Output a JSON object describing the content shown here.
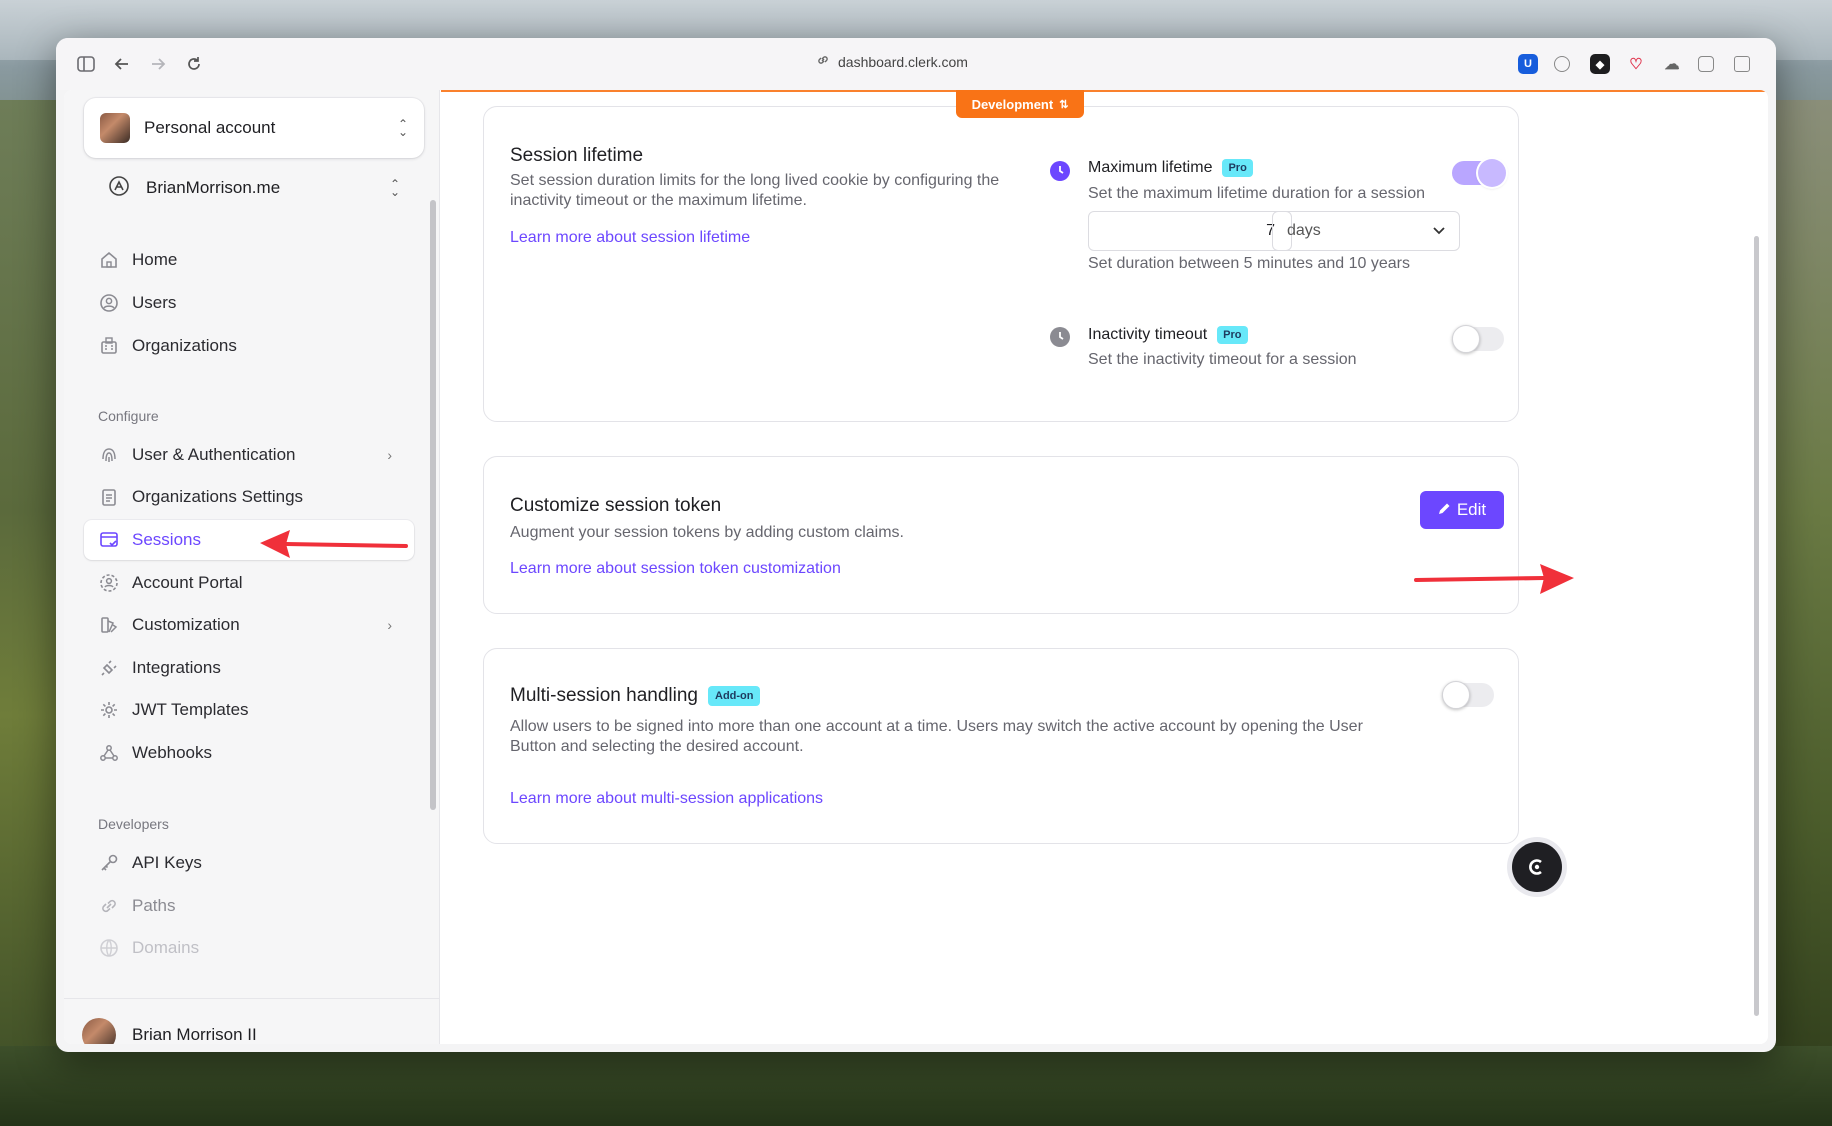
{
  "browser": {
    "url": "dashboard.clerk.com"
  },
  "sidebar": {
    "account": "Personal account",
    "app": "BrianMorrison.me",
    "nav_top": [
      {
        "label": "Home",
        "icon": "home-icon"
      },
      {
        "label": "Users",
        "icon": "users-icon"
      },
      {
        "label": "Organizations",
        "icon": "building-icon"
      }
    ],
    "configure_label": "Configure",
    "configure": [
      {
        "label": "User & Authentication",
        "icon": "fingerprint-icon"
      },
      {
        "label": "Organizations Settings",
        "icon": "clipboard-icon"
      },
      {
        "label": "Sessions",
        "icon": "sessions-icon"
      },
      {
        "label": "Account Portal",
        "icon": "portal-icon"
      },
      {
        "label": "Customization",
        "icon": "customization-icon"
      },
      {
        "label": "Integrations",
        "icon": "plug-icon"
      },
      {
        "label": "JWT Templates",
        "icon": "gear-icon"
      },
      {
        "label": "Webhooks",
        "icon": "webhook-icon"
      }
    ],
    "developers_label": "Developers",
    "developers": [
      {
        "label": "API Keys",
        "icon": "key-icon"
      },
      {
        "label": "Paths",
        "icon": "link-icon"
      },
      {
        "label": "Domains",
        "icon": "globe-icon"
      }
    ],
    "user_name": "Brian Morrison II"
  },
  "env_badge": "Development",
  "session_lifetime": {
    "title": "Session lifetime",
    "description": "Set session duration limits for the long lived cookie by configuring the inactivity timeout or the maximum lifetime.",
    "link": "Learn more about session lifetime",
    "max_lifetime": {
      "title": "Maximum lifetime",
      "badge": "Pro",
      "description": "Set the maximum lifetime duration for a session",
      "value": "7",
      "unit": "days",
      "hint": "Set duration between 5 minutes and 10 years",
      "enabled": true
    },
    "inactivity": {
      "title": "Inactivity timeout",
      "badge": "Pro",
      "description": "Set the inactivity timeout for a session",
      "enabled": false
    }
  },
  "session_token": {
    "title": "Customize session token",
    "description": "Augment your session tokens by adding custom claims.",
    "link": "Learn more about session token customization",
    "edit_label": "Edit"
  },
  "multi_session": {
    "title": "Multi-session handling",
    "badge": "Add-on",
    "description": "Allow users to be signed into more than one account at a time. Users may switch the active account by opening the User Button and selecting the desired account.",
    "link": "Learn more about multi-session applications",
    "enabled": false
  },
  "colors": {
    "accent": "#6c47ff",
    "dev_badge": "#f97316",
    "pro_badge": "#67e8f9",
    "annotation_arrow": "#f0303a"
  }
}
